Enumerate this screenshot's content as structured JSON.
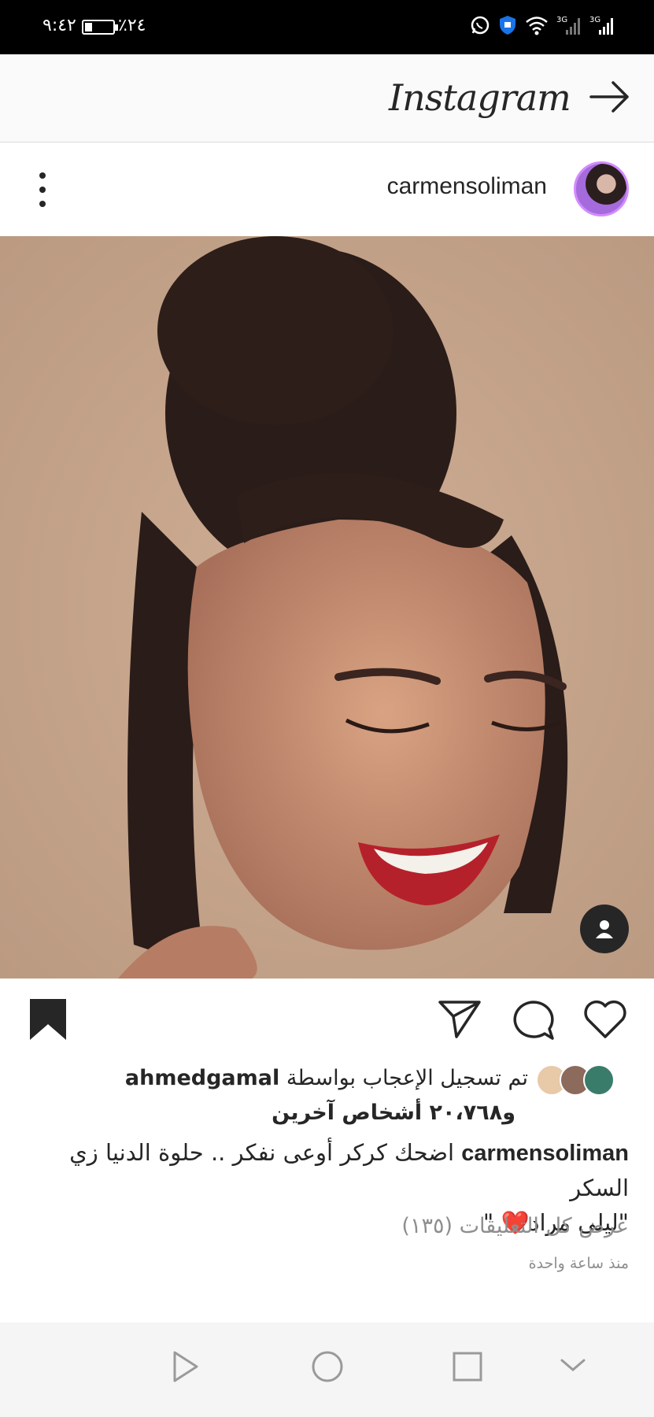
{
  "status_bar": {
    "time": "٩:٤٢",
    "battery_percent": "٪٢٤",
    "battery_level": 0.24,
    "network_labels": [
      "3G",
      "3G"
    ],
    "icons": [
      "whatsapp-icon",
      "shield-icon",
      "wifi-icon",
      "signal-icon",
      "signal-icon"
    ]
  },
  "header": {
    "logo": "Instagram",
    "forward_icon": "arrow-right-icon"
  },
  "post": {
    "username": "carmensoliman",
    "more_icon": "more-vertical-icon",
    "tag_icon": "person-icon"
  },
  "actions": {
    "icons": [
      "heart-icon",
      "comment-icon",
      "send-icon",
      "bookmark-icon"
    ]
  },
  "likes": {
    "prefix": "تم تسجيل الإعجاب بواسطة",
    "user": "ahmedgamal",
    "others": "و٢٠،٧٦٨ أشخاص آخرين"
  },
  "caption": {
    "username": "carmensoliman",
    "text": "اضحك كركر أوعى نفكر .. حلوة الدنيا زي السكر",
    "line2_a": "\"ليلى مراد",
    "line2_emoji": "❤️",
    "line2_b": " \""
  },
  "comments": {
    "view_all": "عرض كل التعليقات (١٣٥)"
  },
  "timestamp": "منذ ساعة واحدة",
  "colors": {
    "text": "#262626",
    "muted": "#8e8e8e",
    "heart": "#e0102b",
    "photo_bg": "#c5a48c"
  }
}
